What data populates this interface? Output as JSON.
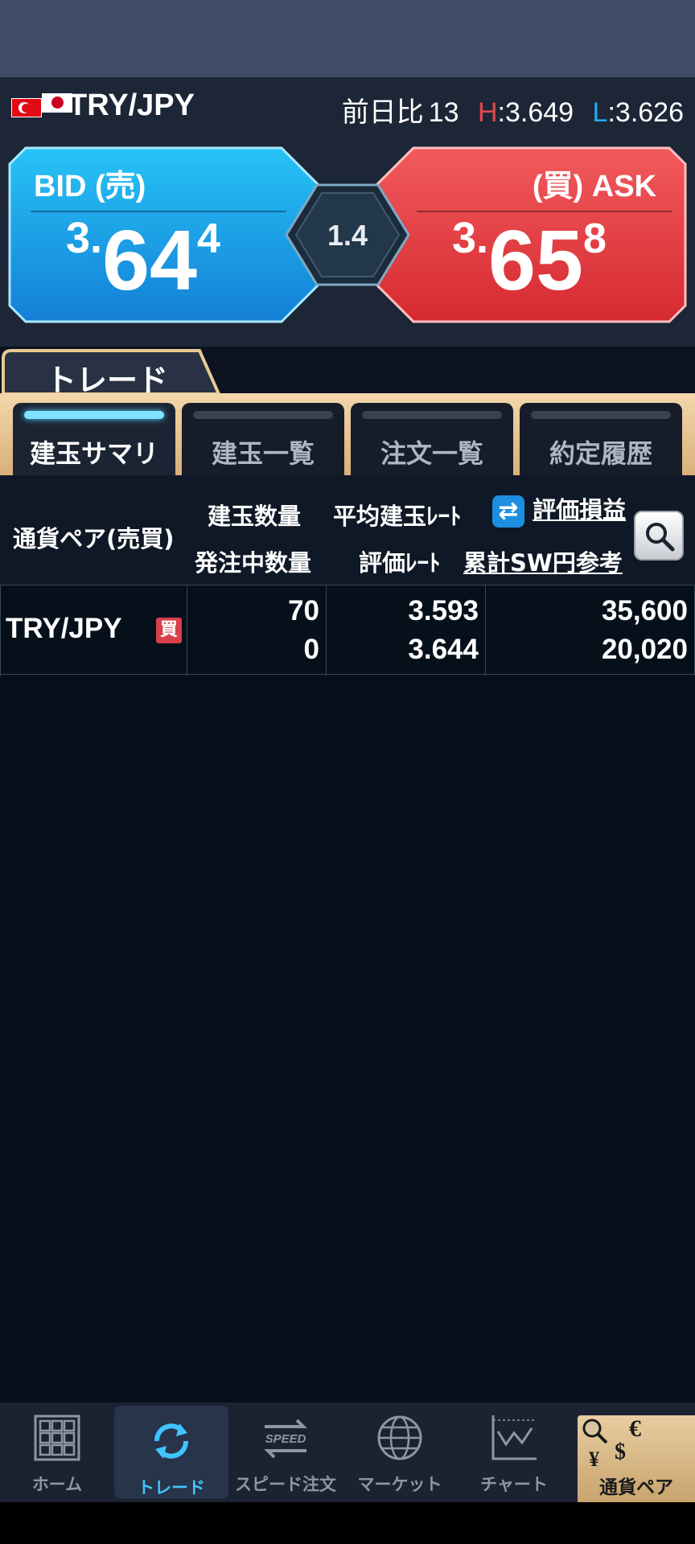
{
  "header": {
    "pair": "TRY/JPY",
    "change_label": "前日比",
    "change_value": "13",
    "high_letter": "H",
    "high_value": ":3.649",
    "low_letter": "L",
    "low_value": ":3.626"
  },
  "bid": {
    "label": "BID (売)",
    "price_prefix": "3.",
    "price_main": "64",
    "price_suffix": "4"
  },
  "ask": {
    "label": "(買) ASK",
    "price_prefix": "3.",
    "price_main": "65",
    "price_suffix": "8"
  },
  "spread": "1.4",
  "trade": {
    "title": "トレード",
    "tabs": [
      {
        "label": "建玉サマリ",
        "active": true
      },
      {
        "label": "建玉一覧",
        "active": false
      },
      {
        "label": "注文一覧",
        "active": false
      },
      {
        "label": "約定履歴",
        "active": false
      }
    ]
  },
  "columns": {
    "pair": "通貨ペア(売買)",
    "position_qty": "建玉数量",
    "pending_qty": "発注中数量",
    "avg_rate": "平均建玉ﾚｰﾄ",
    "valuation_rate": "評価ﾚｰﾄ",
    "swap_icon": "⇄",
    "pnl": "評価損益",
    "cumulative_sw": "累計SW円参考"
  },
  "rows": [
    {
      "pair": "TRY/JPY",
      "side": "買",
      "position_qty": "70",
      "pending_qty": "0",
      "avg_rate": "3.593",
      "valuation_rate": "3.644",
      "pnl": "35,600",
      "cumulative_sw": "20,020"
    }
  ],
  "nav": {
    "items": [
      {
        "label": "ホーム",
        "icon": "home-grid-icon"
      },
      {
        "label": "トレード",
        "icon": "trade-cycle-icon",
        "active": true
      },
      {
        "label": "スピード注文",
        "icon": "speed-order-icon",
        "icon_text": "SPEED"
      },
      {
        "label": "マーケット",
        "icon": "globe-icon"
      },
      {
        "label": "チャート",
        "icon": "chart-icon"
      }
    ],
    "currency_pair": {
      "label": "通貨ペア",
      "symbols": [
        "€",
        "$",
        "¥"
      ]
    }
  },
  "colors": {
    "bid": "#1ea6ea",
    "ask": "#e23a3f",
    "accent": "#3fc4ff"
  }
}
